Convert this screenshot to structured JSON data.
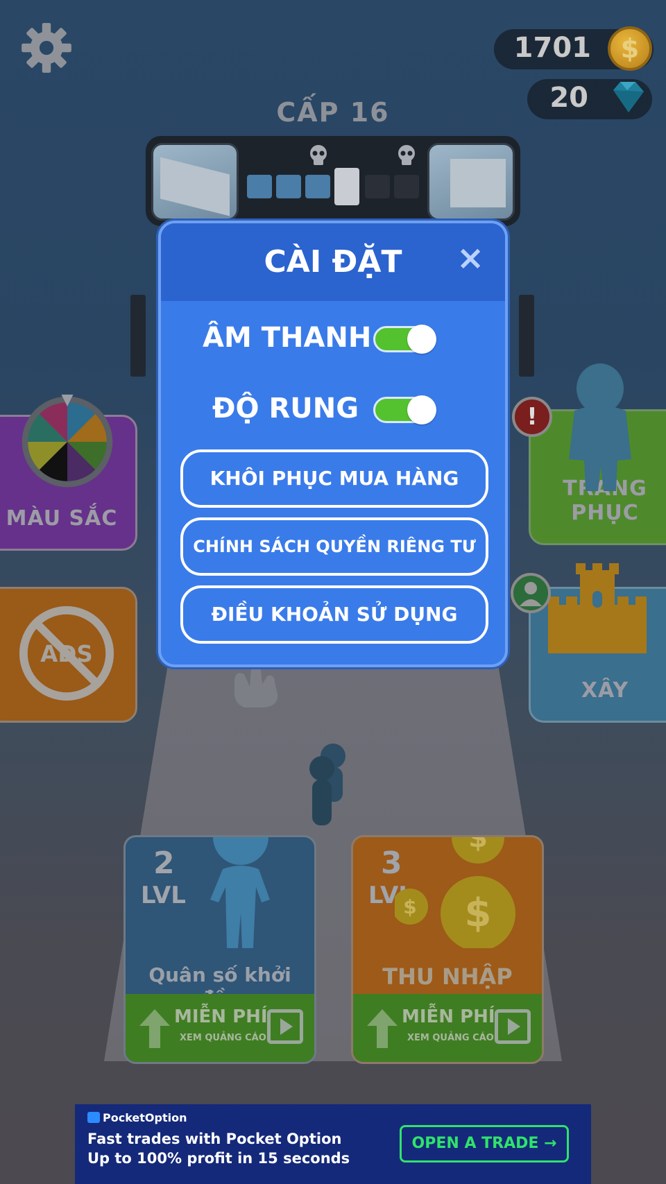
{
  "hud": {
    "coins": "1701",
    "coin_symbol": "$",
    "gems": "20",
    "level_title": "CẤP 16"
  },
  "progress": {
    "segments": [
      "done",
      "done",
      "done",
      "current",
      "locked",
      "locked"
    ],
    "colors": {
      "done": "#4a7da8",
      "current": "#c9ccd2",
      "locked": "#2a2f38"
    }
  },
  "side_tiles": {
    "color_label": "MÀU SẮC",
    "ads_label": "ADS",
    "outfit_label": "TRANG PHỤC",
    "outfit_badge": "!",
    "build_label": "XÂY"
  },
  "cards": [
    {
      "level": "2",
      "lvl": "LVL",
      "title": "Quân số khởi đầu",
      "free": "MIỄN PHÍ",
      "free_sub": "XEM QUẢNG CÁO"
    },
    {
      "level": "3",
      "lvl": "LVL",
      "title": "THU NHẬP",
      "free": "MIỄN PHÍ",
      "free_sub": "XEM QUẢNG CÁO"
    }
  ],
  "dialog": {
    "title": "CÀI ĐẶT",
    "close": "×",
    "sound_label": "ÂM THANH",
    "sound_on": true,
    "vibration_label": "ĐỘ RUNG",
    "vibration_on": true,
    "restore_button": "KHÔI PHỤC MUA HÀNG",
    "privacy_button": "CHÍNH SÁCH QUYỀN RIÊNG TƯ",
    "terms_button": "ĐIỀU KHOẢN SỬ DỤNG"
  },
  "ad": {
    "brand": "PocketOption",
    "line1": "Fast trades with Pocket Option",
    "line2": "Up to 100% profit in 15 seconds",
    "cta": "OPEN A TRADE →"
  },
  "colors": {
    "dialog_bg": "#3a7bea",
    "dialog_header": "#2b63cf",
    "toggle_on": "#54c22e",
    "ad_bg": "#15297a",
    "ad_cta": "#2fe36b"
  }
}
